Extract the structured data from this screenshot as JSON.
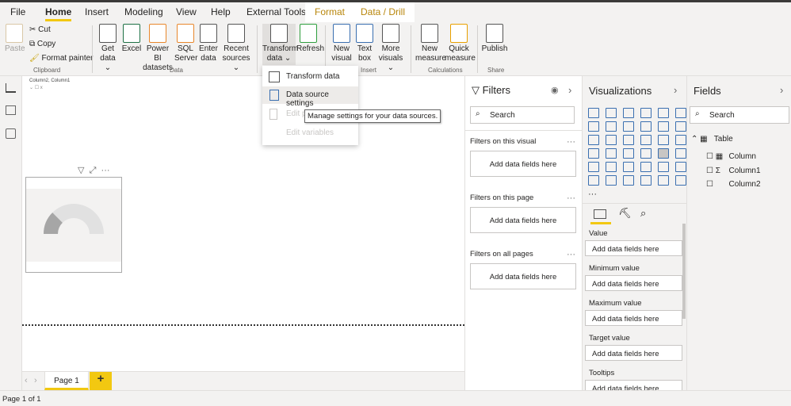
{
  "ribbon_tabs": [
    "File",
    "Home",
    "Insert",
    "Modeling",
    "View",
    "Help",
    "External Tools"
  ],
  "context_tabs": [
    "Format",
    "Data / Drill"
  ],
  "active_tab": "Home",
  "clipboard": {
    "paste": "Paste",
    "cut": "Cut",
    "copy": "Copy",
    "format_painter": "Format painter",
    "group": "Clipboard"
  },
  "data_group": {
    "get_data": [
      "Get",
      "data ⌄"
    ],
    "excel": [
      "Excel",
      ""
    ],
    "pbi": [
      "Power BI",
      "datasets"
    ],
    "sql": [
      "SQL",
      "Server"
    ],
    "enter": [
      "Enter",
      "data"
    ],
    "recent": [
      "Recent",
      "sources ⌄"
    ],
    "group": "Data"
  },
  "queries": {
    "transform": [
      "Transform",
      "data ⌄"
    ],
    "refresh": [
      "Refresh",
      ""
    ]
  },
  "insert": {
    "new_visual": [
      "New",
      "visual"
    ],
    "text_box": [
      "Text",
      "box"
    ],
    "more": [
      "More",
      "visuals ⌄"
    ],
    "group": "Insert"
  },
  "calc": {
    "new_measure": [
      "New",
      "measure"
    ],
    "quick": [
      "Quick",
      "measure"
    ],
    "group": "Calculations"
  },
  "share": {
    "publish": "Publish",
    "group": "Share"
  },
  "dropdown": {
    "items": [
      "Transform data",
      "Data source settings",
      "Edit parameters",
      "Edit variables"
    ],
    "tooltip": "Manage settings for your data sources.",
    "edit_p": "Edit p"
  },
  "canvas": {
    "slicer_title": "Column2, Column1",
    "slicer_item": "x",
    "gauge_fill_fraction": 0.25
  },
  "filters": {
    "title": "Filters",
    "search": "Search",
    "sections": [
      "Filters on this visual",
      "Filters on this page",
      "Filters on all pages"
    ],
    "add": "Add data fields here"
  },
  "visualizations": {
    "title": "Visualizations",
    "more": "···",
    "wells": [
      "Value",
      "Minimum value",
      "Maximum value",
      "Target value",
      "Tooltips"
    ],
    "add": "Add data fields here"
  },
  "fields": {
    "title": "Fields",
    "search": "Search",
    "table": "Table",
    "columns": [
      "Column",
      "Column1",
      "Column2"
    ],
    "column_icons": [
      "table-icon",
      "sigma-icon",
      ""
    ]
  },
  "pages": {
    "tabs": [
      "Page 1"
    ],
    "add": "+"
  },
  "status": "Page 1 of 1",
  "colors": {
    "accent": "#f2c811",
    "selected_tab": "#b8860b",
    "viz_blue": "#3a6fb0"
  }
}
